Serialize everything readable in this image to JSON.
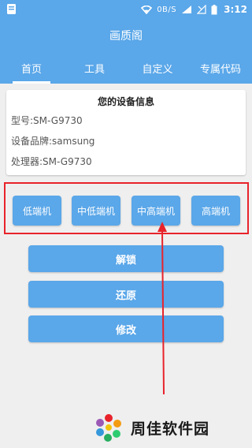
{
  "status_bar": {
    "net_speed": "0B/S",
    "time": "3:12"
  },
  "app": {
    "title": "画质阁"
  },
  "tabs": [
    {
      "label": "首页",
      "active": true
    },
    {
      "label": "工具",
      "active": false
    },
    {
      "label": "自定义",
      "active": false
    },
    {
      "label": "专属代码",
      "active": false
    }
  ],
  "device_info": {
    "title": "您的设备信息",
    "model": "型号:SM-G9730",
    "brand": "设备品牌:samsung",
    "processor": "处理器:SM-G9730"
  },
  "tiers": [
    {
      "label": "低端机"
    },
    {
      "label": "中低端机"
    },
    {
      "label": "中高端机"
    },
    {
      "label": "高端机"
    }
  ],
  "actions": {
    "unlock": "解锁",
    "restore": "还原",
    "modify": "修改"
  },
  "watermark": {
    "text": "周佳软件园"
  },
  "colors": {
    "primary": "#5aa7e9",
    "highlight": "#e8232b",
    "background": "#efefef"
  }
}
